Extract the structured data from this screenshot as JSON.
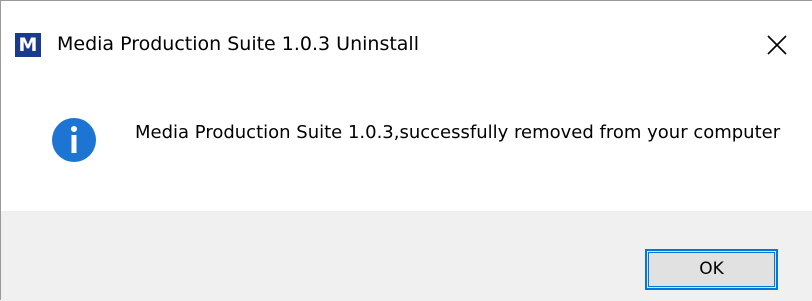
{
  "window": {
    "title": "Media Production Suite 1.0.3 Uninstall",
    "app_icon_letter": "M",
    "app_icon_color": "#1a3a8c"
  },
  "message": {
    "text": "Media Production Suite 1.0.3,successfully removed from your computer",
    "icon": "info-icon",
    "icon_color": "#1c74d3"
  },
  "buttons": {
    "ok_label": "OK",
    "accent_color": "#0078d7"
  }
}
